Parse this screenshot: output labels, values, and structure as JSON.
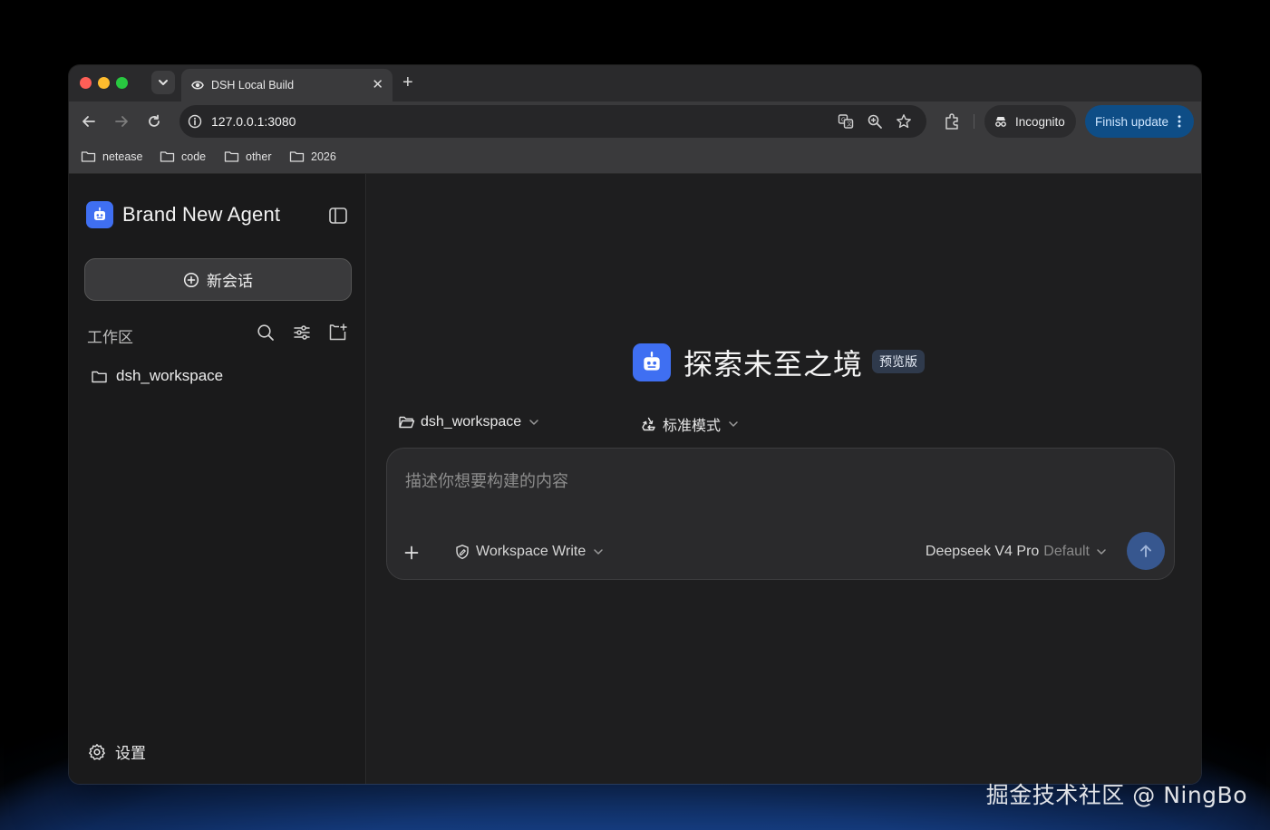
{
  "browser": {
    "tab_title": "DSH Local Build",
    "url": "127.0.0.1:3080",
    "incognito_label": "Incognito",
    "finish_update_label": "Finish update",
    "bookmarks": [
      "netease",
      "code",
      "other",
      "2026"
    ]
  },
  "sidebar": {
    "brand": "Brand New Agent",
    "new_chat_label": "新会话",
    "workspace_label": "工作区",
    "workspaces": [
      "dsh_workspace"
    ],
    "settings_label": "设置"
  },
  "main": {
    "hero_title": "探索未至之境",
    "hero_badge": "预览版",
    "workspace_selector": "dsh_workspace",
    "mode_selector": "标准模式",
    "composer_placeholder": "描述你想要构建的内容",
    "permission_label": "Workspace Write",
    "model_name": "Deepseek V4 Pro",
    "model_tag": "Default"
  },
  "watermark": "掘金技术社区 @ NingBo",
  "colors": {
    "accent": "#3f6ff2",
    "send_button": "#37578f",
    "finish_update_bg": "#0e4d86"
  }
}
